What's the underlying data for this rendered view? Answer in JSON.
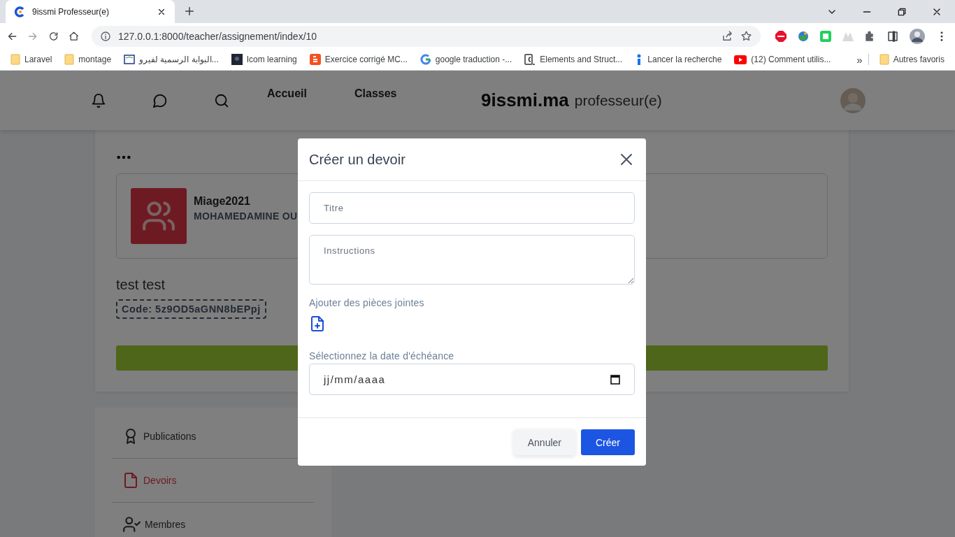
{
  "browser": {
    "tab_title": "9issmi Professeur(e)",
    "url": "127.0.0.1:8000/teacher/assignement/index/10",
    "bookmarks": [
      {
        "label": "Laravel",
        "kind": "folder"
      },
      {
        "label": "montage",
        "kind": "folder"
      },
      {
        "label": "البوابة الرسمية لفيرو...",
        "kind": "portal"
      },
      {
        "label": "Icom learning",
        "kind": "dark"
      },
      {
        "label": "Exercice corrigé MC...",
        "kind": "blogger"
      },
      {
        "label": "google traduction -...",
        "kind": "google"
      },
      {
        "label": "Elements and Struct...",
        "kind": "code"
      },
      {
        "label": "Lancer la recherche",
        "kind": "info"
      },
      {
        "label": "(12) Comment utilis...",
        "kind": "youtube"
      }
    ],
    "more": "»",
    "other_bookmarks": "Autres favoris"
  },
  "header": {
    "nav_links": [
      "Accueil",
      "Classes"
    ],
    "brand": "9issmi.ma",
    "brand_suffix": "professeur(e)"
  },
  "class_card": {
    "name": "Miage2021",
    "teacher": "MOHAMEDAMINE OU",
    "title": "test test",
    "code": "Code: 5z9OD5aGNN8bEPpj"
  },
  "sidebar": {
    "items": [
      {
        "label": "Publications",
        "kind": "award",
        "selected": false
      },
      {
        "label": "Devoirs",
        "kind": "file",
        "selected": true
      },
      {
        "label": "Membres",
        "kind": "user",
        "selected": false
      }
    ]
  },
  "modal": {
    "title": "Créer un devoir",
    "title_placeholder": "Titre",
    "instructions_placeholder": "Instructions",
    "attachments_label": "Ajouter des pièces jointes",
    "due_label": "Sélectionnez la date d'échéance",
    "date_placeholder": "jj/mm/aaaa",
    "buttons": [
      {
        "label": "Annuler",
        "kind": "secondary"
      },
      {
        "label": "Créer",
        "kind": "primary"
      }
    ]
  }
}
